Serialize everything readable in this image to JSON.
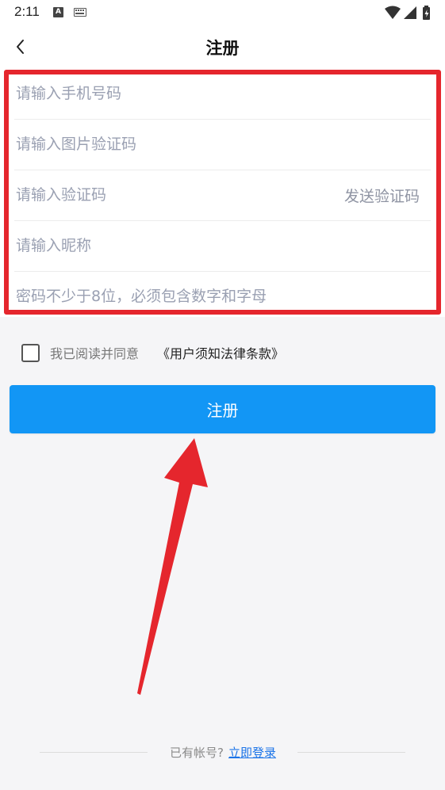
{
  "status_bar": {
    "time": "2:11",
    "icons": [
      "a-notification-icon",
      "keyboard-icon",
      "wifi-icon",
      "signal-icon",
      "battery-charging-icon"
    ]
  },
  "header": {
    "title": "注册",
    "back_icon": "chevron-left-icon"
  },
  "form": {
    "phone_placeholder": "请输入手机号码",
    "image_captcha_placeholder": "请输入图片验证码",
    "sms_code_placeholder": "请输入验证码",
    "send_code_label": "发送验证码",
    "nickname_placeholder": "请输入昵称",
    "password_placeholder": "密码不少于8位，必须包含数字和字母"
  },
  "agreement": {
    "text": "我已阅读并同意",
    "terms_link": "《用户须知法律条款》",
    "checked": false
  },
  "register_button": {
    "label": "注册"
  },
  "footer": {
    "text": "已有帐号?",
    "login_link": "立即登录"
  },
  "colors": {
    "accent": "#1296f5",
    "highlight_annotation": "#e5262d",
    "link": "#1a73e8"
  }
}
